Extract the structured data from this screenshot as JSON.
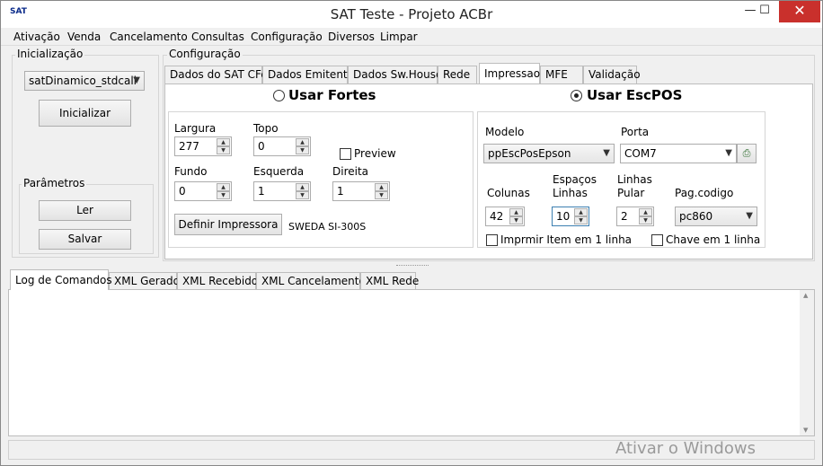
{
  "window": {
    "title": "SAT Teste - Projeto ACBr",
    "minimize": "—",
    "maximize": "☐",
    "close": "✕",
    "icon": "sat-app-icon",
    "icon_text": "SAT"
  },
  "menu": [
    "Ativação",
    "Venda",
    "Cancelamento",
    "Consultas",
    "Configuração",
    "Diversos",
    "Limpar"
  ],
  "init": {
    "title": "Inicialização",
    "library": "satDinamico_stdcall",
    "initialize_button": "Inicializar",
    "params_title": "Parâmetros",
    "read_button": "Ler",
    "save_button": "Salvar"
  },
  "config": {
    "title": "Configuração",
    "tabs": [
      "Dados do SAT CFe",
      "Dados Emitente",
      "Dados Sw.House",
      "Rede",
      "Impressao",
      "MFE",
      "Validação"
    ],
    "active_tab": "Impressao"
  },
  "fortes": {
    "radio_label": "Usar Fortes",
    "selected": false,
    "largura_label": "Largura",
    "largura": "277",
    "topo_label": "Topo",
    "topo": "0",
    "preview_label": "Preview",
    "preview": false,
    "fundo_label": "Fundo",
    "fundo": "0",
    "esquerda_label": "Esquerda",
    "esquerda": "1",
    "direita_label": "Direita",
    "direita": "1",
    "define_printer_button": "Definir Impressora",
    "printer_name": "SWEDA SI-300S"
  },
  "escpos": {
    "radio_label": "Usar EscPOS",
    "selected": true,
    "modelo_label": "Modelo",
    "modelo": "ppEscPosEpson",
    "porta_label": "Porta",
    "porta": "COM7",
    "colunas_label": "Colunas",
    "colunas": "42",
    "espacos_label_1": "Espaços",
    "espacos_label_2": "Linhas",
    "espacos": "10",
    "linhas_label_1": "Linhas",
    "linhas_label_2": "Pular",
    "linhas_pular": "2",
    "pagcodigo_label": "Pag.codigo",
    "pagcodigo": "pc860",
    "imprimir_item_label": "Imprmir Item em 1 linha",
    "chave_label": "Chave em 1 linha"
  },
  "log": {
    "tabs": [
      "Log de Comandos",
      "XML Gerado",
      "XML Recebido",
      "XML Cancelamento",
      "XML Rede"
    ],
    "active_tab": "Log de Comandos",
    "content": ""
  },
  "watermark": "Ativar o Windows"
}
